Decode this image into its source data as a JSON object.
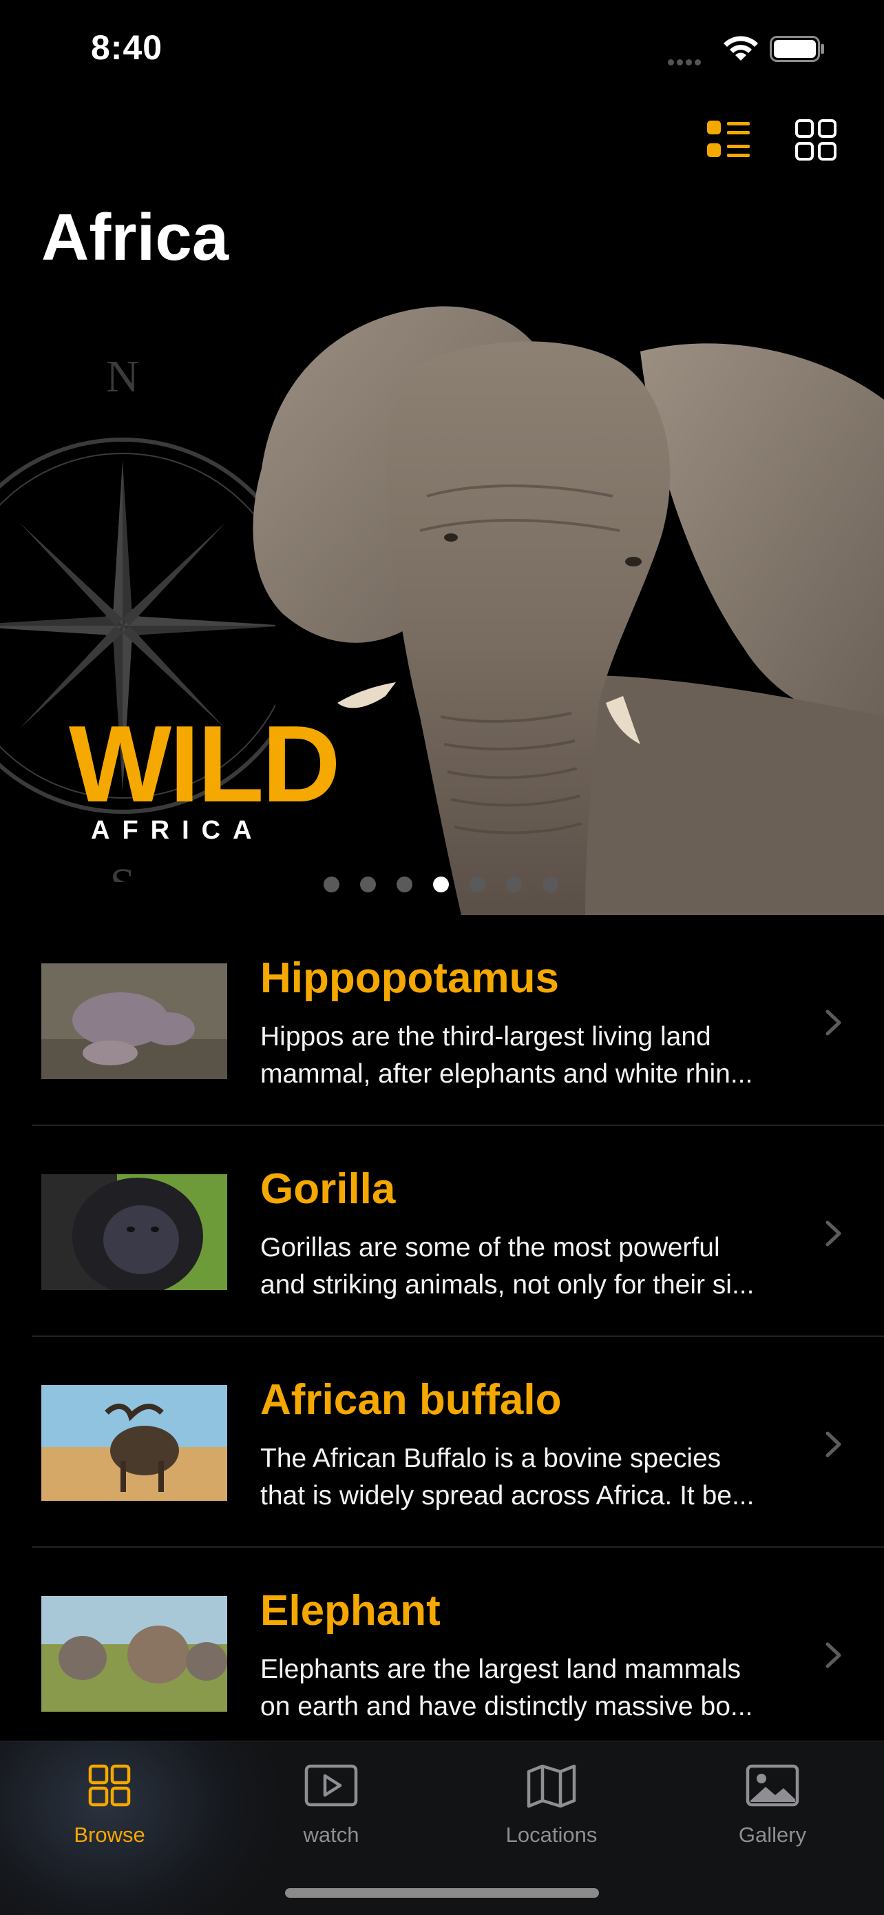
{
  "status": {
    "time": "8:40"
  },
  "header": {
    "title": "Africa"
  },
  "hero": {
    "logo_word": "WILD",
    "logo_sub": "AFRICA",
    "compass_north": "N",
    "compass_south": "S",
    "page_count": 7,
    "active_page": 4
  },
  "animals": [
    {
      "name": "Hippopotamus",
      "desc_line1": "Hippos are the third-largest living land",
      "desc_line2": "mammal, after elephants and white rhin..."
    },
    {
      "name": "Gorilla",
      "desc_line1": "Gorillas are some of the most powerful",
      "desc_line2": "and striking animals, not only for their si..."
    },
    {
      "name": "African buffalo",
      "desc_line1": "The African Buffalo is a bovine species",
      "desc_line2": "that is widely spread across Africa. It be..."
    },
    {
      "name": "Elephant",
      "desc_line1": "Elephants are the largest land mammals",
      "desc_line2": "on earth and have distinctly massive bo..."
    }
  ],
  "tabs": [
    {
      "label": "Browse",
      "icon": "grid-icon",
      "active": true
    },
    {
      "label": "watch",
      "icon": "play-icon",
      "active": false
    },
    {
      "label": "Locations",
      "icon": "map-icon",
      "active": false
    },
    {
      "label": "Gallery",
      "icon": "photo-icon",
      "active": false
    }
  ],
  "colors": {
    "accent": "#f5a800",
    "background": "#000000",
    "inactive": "#8e8e93"
  }
}
